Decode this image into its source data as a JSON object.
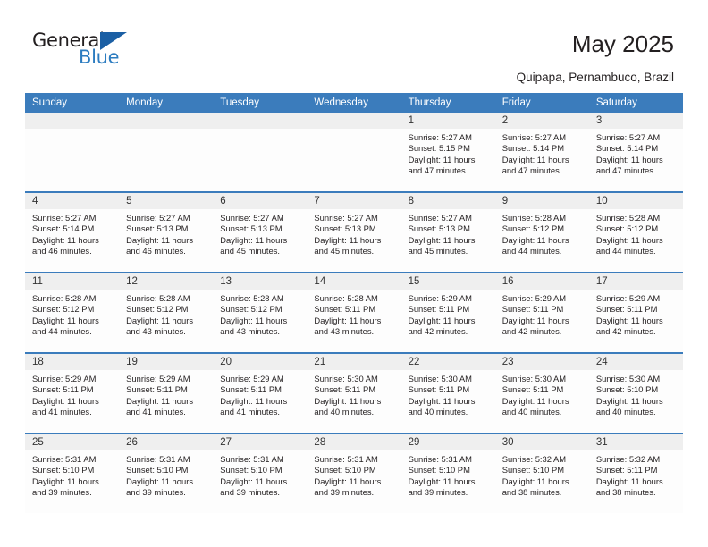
{
  "brand": {
    "name_top": "General",
    "name_bottom": "Blue",
    "triangle_color": "#1b5fa4",
    "blue_color": "#2c7cc0"
  },
  "header": {
    "title": "May 2025",
    "location": "Quipapa, Pernambuco, Brazil"
  },
  "theme": {
    "header_bar": "#3b7cbc",
    "daynum_band": "#efefef",
    "cell_bg": "#fdfdfd",
    "text": "#231f20"
  },
  "weekdays": [
    "Sunday",
    "Monday",
    "Tuesday",
    "Wednesday",
    "Thursday",
    "Friday",
    "Saturday"
  ],
  "weeks": [
    [
      {
        "day": "",
        "sunrise": "",
        "sunset": "",
        "daylight": ""
      },
      {
        "day": "",
        "sunrise": "",
        "sunset": "",
        "daylight": ""
      },
      {
        "day": "",
        "sunrise": "",
        "sunset": "",
        "daylight": ""
      },
      {
        "day": "",
        "sunrise": "",
        "sunset": "",
        "daylight": ""
      },
      {
        "day": "1",
        "sunrise": "Sunrise: 5:27 AM",
        "sunset": "Sunset: 5:15 PM",
        "daylight": "Daylight: 11 hours and 47 minutes."
      },
      {
        "day": "2",
        "sunrise": "Sunrise: 5:27 AM",
        "sunset": "Sunset: 5:14 PM",
        "daylight": "Daylight: 11 hours and 47 minutes."
      },
      {
        "day": "3",
        "sunrise": "Sunrise: 5:27 AM",
        "sunset": "Sunset: 5:14 PM",
        "daylight": "Daylight: 11 hours and 47 minutes."
      }
    ],
    [
      {
        "day": "4",
        "sunrise": "Sunrise: 5:27 AM",
        "sunset": "Sunset: 5:14 PM",
        "daylight": "Daylight: 11 hours and 46 minutes."
      },
      {
        "day": "5",
        "sunrise": "Sunrise: 5:27 AM",
        "sunset": "Sunset: 5:13 PM",
        "daylight": "Daylight: 11 hours and 46 minutes."
      },
      {
        "day": "6",
        "sunrise": "Sunrise: 5:27 AM",
        "sunset": "Sunset: 5:13 PM",
        "daylight": "Daylight: 11 hours and 45 minutes."
      },
      {
        "day": "7",
        "sunrise": "Sunrise: 5:27 AM",
        "sunset": "Sunset: 5:13 PM",
        "daylight": "Daylight: 11 hours and 45 minutes."
      },
      {
        "day": "8",
        "sunrise": "Sunrise: 5:27 AM",
        "sunset": "Sunset: 5:13 PM",
        "daylight": "Daylight: 11 hours and 45 minutes."
      },
      {
        "day": "9",
        "sunrise": "Sunrise: 5:28 AM",
        "sunset": "Sunset: 5:12 PM",
        "daylight": "Daylight: 11 hours and 44 minutes."
      },
      {
        "day": "10",
        "sunrise": "Sunrise: 5:28 AM",
        "sunset": "Sunset: 5:12 PM",
        "daylight": "Daylight: 11 hours and 44 minutes."
      }
    ],
    [
      {
        "day": "11",
        "sunrise": "Sunrise: 5:28 AM",
        "sunset": "Sunset: 5:12 PM",
        "daylight": "Daylight: 11 hours and 44 minutes."
      },
      {
        "day": "12",
        "sunrise": "Sunrise: 5:28 AM",
        "sunset": "Sunset: 5:12 PM",
        "daylight": "Daylight: 11 hours and 43 minutes."
      },
      {
        "day": "13",
        "sunrise": "Sunrise: 5:28 AM",
        "sunset": "Sunset: 5:12 PM",
        "daylight": "Daylight: 11 hours and 43 minutes."
      },
      {
        "day": "14",
        "sunrise": "Sunrise: 5:28 AM",
        "sunset": "Sunset: 5:11 PM",
        "daylight": "Daylight: 11 hours and 43 minutes."
      },
      {
        "day": "15",
        "sunrise": "Sunrise: 5:29 AM",
        "sunset": "Sunset: 5:11 PM",
        "daylight": "Daylight: 11 hours and 42 minutes."
      },
      {
        "day": "16",
        "sunrise": "Sunrise: 5:29 AM",
        "sunset": "Sunset: 5:11 PM",
        "daylight": "Daylight: 11 hours and 42 minutes."
      },
      {
        "day": "17",
        "sunrise": "Sunrise: 5:29 AM",
        "sunset": "Sunset: 5:11 PM",
        "daylight": "Daylight: 11 hours and 42 minutes."
      }
    ],
    [
      {
        "day": "18",
        "sunrise": "Sunrise: 5:29 AM",
        "sunset": "Sunset: 5:11 PM",
        "daylight": "Daylight: 11 hours and 41 minutes."
      },
      {
        "day": "19",
        "sunrise": "Sunrise: 5:29 AM",
        "sunset": "Sunset: 5:11 PM",
        "daylight": "Daylight: 11 hours and 41 minutes."
      },
      {
        "day": "20",
        "sunrise": "Sunrise: 5:29 AM",
        "sunset": "Sunset: 5:11 PM",
        "daylight": "Daylight: 11 hours and 41 minutes."
      },
      {
        "day": "21",
        "sunrise": "Sunrise: 5:30 AM",
        "sunset": "Sunset: 5:11 PM",
        "daylight": "Daylight: 11 hours and 40 minutes."
      },
      {
        "day": "22",
        "sunrise": "Sunrise: 5:30 AM",
        "sunset": "Sunset: 5:11 PM",
        "daylight": "Daylight: 11 hours and 40 minutes."
      },
      {
        "day": "23",
        "sunrise": "Sunrise: 5:30 AM",
        "sunset": "Sunset: 5:11 PM",
        "daylight": "Daylight: 11 hours and 40 minutes."
      },
      {
        "day": "24",
        "sunrise": "Sunrise: 5:30 AM",
        "sunset": "Sunset: 5:10 PM",
        "daylight": "Daylight: 11 hours and 40 minutes."
      }
    ],
    [
      {
        "day": "25",
        "sunrise": "Sunrise: 5:31 AM",
        "sunset": "Sunset: 5:10 PM",
        "daylight": "Daylight: 11 hours and 39 minutes."
      },
      {
        "day": "26",
        "sunrise": "Sunrise: 5:31 AM",
        "sunset": "Sunset: 5:10 PM",
        "daylight": "Daylight: 11 hours and 39 minutes."
      },
      {
        "day": "27",
        "sunrise": "Sunrise: 5:31 AM",
        "sunset": "Sunset: 5:10 PM",
        "daylight": "Daylight: 11 hours and 39 minutes."
      },
      {
        "day": "28",
        "sunrise": "Sunrise: 5:31 AM",
        "sunset": "Sunset: 5:10 PM",
        "daylight": "Daylight: 11 hours and 39 minutes."
      },
      {
        "day": "29",
        "sunrise": "Sunrise: 5:31 AM",
        "sunset": "Sunset: 5:10 PM",
        "daylight": "Daylight: 11 hours and 39 minutes."
      },
      {
        "day": "30",
        "sunrise": "Sunrise: 5:32 AM",
        "sunset": "Sunset: 5:10 PM",
        "daylight": "Daylight: 11 hours and 38 minutes."
      },
      {
        "day": "31",
        "sunrise": "Sunrise: 5:32 AM",
        "sunset": "Sunset: 5:11 PM",
        "daylight": "Daylight: 11 hours and 38 minutes."
      }
    ]
  ]
}
